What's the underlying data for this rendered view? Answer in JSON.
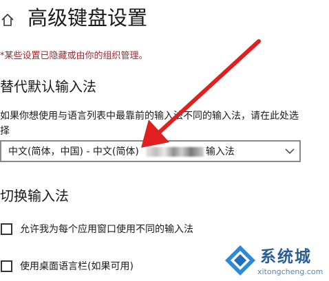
{
  "header": {
    "title": "高级键盘设置",
    "home_icon": "home-icon"
  },
  "org_note": "*某些设置已隐藏或由你的组织管理。",
  "override_section": {
    "title": "替代默认输入法",
    "description": "如果你想使用与语言列表中最靠前的输入法不同的输入法，请在此处选择",
    "dropdown": {
      "value_prefix": "中文(简体，中国) - 中文(简体)",
      "value_suffix": "输入法",
      "icon": "chevron-down-icon"
    }
  },
  "switch_section": {
    "title": "切换输入法",
    "options": [
      {
        "label": "允许我为每个应用窗口使用不同的输入法",
        "checked": false
      },
      {
        "label": "使用桌面语言栏(如果可用)",
        "checked": false
      }
    ]
  },
  "annotation": {
    "arrow_color": "#e02020"
  },
  "watermark": {
    "name": "系统城",
    "url": "xitongcheng.com",
    "color": "#2c5d93"
  }
}
